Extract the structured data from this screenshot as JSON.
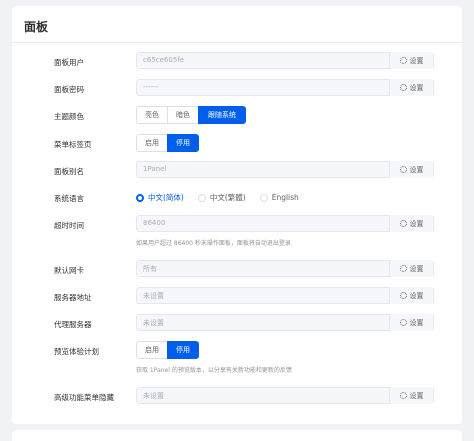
{
  "panel": {
    "title": "面板",
    "set_label": "设置",
    "user": {
      "label": "面板用户",
      "value": "c65ce605fe"
    },
    "password": {
      "label": "面板密码",
      "value": "------"
    },
    "theme": {
      "label": "主题颜色",
      "options": [
        "亮色",
        "暗色",
        "跟随系统"
      ],
      "selected": "跟随系统"
    },
    "menu_tabs": {
      "label": "菜单标签页",
      "options": [
        "启用",
        "停用"
      ],
      "selected": "停用"
    },
    "alias": {
      "label": "面板别名",
      "value": "1Panel"
    },
    "language": {
      "label": "系统语言",
      "options": [
        "中文(简体)",
        "中文(繁體)",
        "English"
      ],
      "selected": "中文(简体)"
    },
    "timeout": {
      "label": "超时时间",
      "value": "86400",
      "hint": "如果用户超过 86400 秒未操作面板，面板将自动退出登录"
    },
    "nic": {
      "label": "默认网卡",
      "value": "所有"
    },
    "server_addr": {
      "label": "服务器地址",
      "value": "未设置"
    },
    "proxy": {
      "label": "代理服务器",
      "value": "未设置"
    },
    "preview": {
      "label": "预览体验计划",
      "options": [
        "启用",
        "停用"
      ],
      "selected": "停用",
      "hint": "获取 1Panel 的预览版本，以分享有关新功能和更新的反馈"
    },
    "hidden_menu": {
      "label": "高级功能菜单隐藏",
      "value": "未设置"
    }
  },
  "colors": {
    "accent": "#005eeb",
    "background": "#f0f2f5"
  }
}
